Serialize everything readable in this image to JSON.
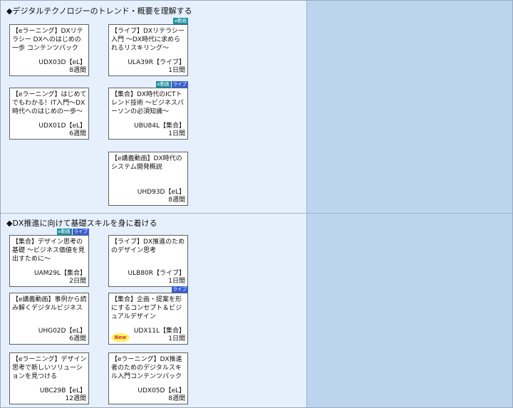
{
  "sections": [
    {
      "title": "◆デジタルテクノロジーのトレンド・概要を理解する",
      "courses": [
        {
          "title": "【eラーニング】DXリテラシー DXへのはじめの一歩 コンテンツパック",
          "code": "UDX03D【eL】",
          "duration": "8週間",
          "badges": []
        },
        {
          "title": "【ライブ】DXリテラシー入門 〜DX時代に求められるリスキリング〜",
          "code": "ULA39R【ライブ】",
          "duration": "1日間",
          "badges": [
            "e動画"
          ]
        },
        {
          "title": "【eラーニング】はじめてでもわかる！IT入門〜DX時代へのはじめの一歩〜",
          "code": "UDX01D【eL】",
          "duration": "6週間",
          "badges": []
        },
        {
          "title": "【集合】DX時代のICTトレンド技術 〜ビジネスパーソンの必須知識〜",
          "code": "UBU84L【集合】",
          "duration": "1日間",
          "badges": [
            "e動画",
            "ライブ"
          ]
        },
        {
          "title": "【e講義動画】DX時代のシステム開発概説",
          "code": "UHD93D【eL】",
          "duration": "8週間",
          "badges": []
        }
      ]
    },
    {
      "title": "◆DX推進に向けて基礎スキルを身に着ける",
      "courses": [
        {
          "title": "【集合】デザイン思考の基礎 〜ビジネス価値を見出すために〜",
          "code": "UAM29L【集合】",
          "duration": "2日間",
          "badges": [
            "e動画",
            "ライブ"
          ]
        },
        {
          "title": "【ライブ】DX推進のためのデザイン思考",
          "code": "ULB80R【ライブ】",
          "duration": "1日間",
          "badges": []
        },
        {
          "title": "【e講義動画】事例から読み解くデジタルビジネス",
          "code": "UHG02D【eL】",
          "duration": "6週間",
          "badges": []
        },
        {
          "title": "【集合】企画・提案を形にするコンセプト＆ビジュアルデザイン",
          "code": "UDX11L【集合】",
          "duration": "1日間",
          "badges": [
            "ライブ"
          ],
          "new_label": "New"
        },
        {
          "title": "【eラーニング】デザイン思考で新しいソリューションを見つける",
          "code": "UBC29B【eL】",
          "duration": "12週間",
          "badges": []
        },
        {
          "title": "【eラーニング】DX推進者のためのデジタルスキル入門コンテンツパック",
          "code": "UDX05D【eL】",
          "duration": "8週間",
          "badges": []
        }
      ]
    }
  ],
  "colors": {
    "left_panel": "#e5f0fc",
    "right_panel": "#bcd4ee",
    "badge_edouga": "#1b8fa0",
    "badge_live": "#3a5fd2",
    "new_highlight": "#fff25a",
    "new_text": "#d4303a"
  }
}
